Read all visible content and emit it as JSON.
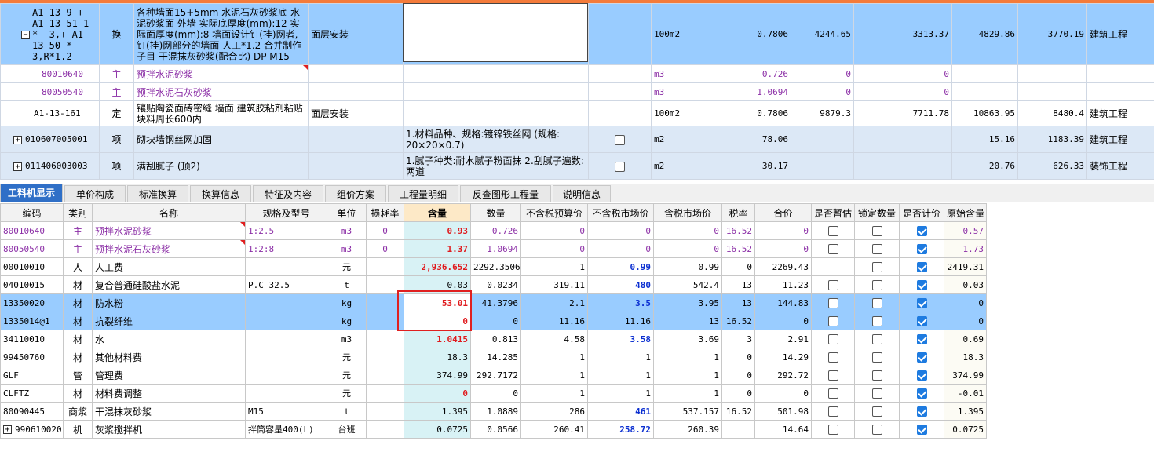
{
  "top_rows": [
    {
      "code": "A1-13-9 + A1-13-51-1 * -3,+ A1-13-50 * 3,R*1.2",
      "type": "换",
      "name": "各种墙面15+5mm 水泥石灰砂浆底 水泥砂浆面 外墙 实际底厚度(mm):12 实际面厚度(mm):8 墙面设计钉(挂)网者,钉(挂)网部分的墙面 人工*1.2 合并制作子目 干混抹灰砂浆(配合比) DP M15",
      "feature": "面层安装",
      "unit": "100m2",
      "qty": "0.7806",
      "p1": "4244.65",
      "p2": "3313.37",
      "p3": "4829.86",
      "p4": "3770.19",
      "major": "建筑工程"
    },
    {
      "code": "80010640",
      "type": "主",
      "name": "预拌水泥砂浆",
      "unit": "m3",
      "qty": "0.726",
      "p1": "0",
      "p2": "0"
    },
    {
      "code": "80050540",
      "type": "主",
      "name": "预拌水泥石灰砂浆",
      "unit": "m3",
      "qty": "1.0694",
      "p1": "0",
      "p2": "0"
    },
    {
      "code": "A1-13-161",
      "type": "定",
      "name": "镶贴陶瓷面砖密缝 墙面 建筑胶粘剂粘贴 块料周长600内",
      "feature": "面层安装",
      "unit": "100m2",
      "qty": "0.7806",
      "p1": "9879.3",
      "p2": "7711.78",
      "p3": "10863.95",
      "p4": "8480.4",
      "major": "建筑工程"
    },
    {
      "code": "010607005001",
      "type": "项",
      "name": "砌块墙钢丝网加固",
      "spec": "1.材料品种、规格:镀锌铁丝网 (规格: 20×20×0.7)",
      "unit": "m2",
      "qty": "78.06",
      "p3": "15.16",
      "p4": "1183.39",
      "major": "建筑工程"
    },
    {
      "code": "011406003003",
      "type": "项",
      "name": "满刮腻子 (顶2)",
      "spec": "1.腻子种类:耐水腻子粉面抹 2.刮腻子遍数:两道",
      "unit": "m2",
      "qty": "30.17",
      "p3": "20.76",
      "p4": "626.33",
      "major": "装饰工程"
    }
  ],
  "tabs": [
    "工料机显示",
    "单价构成",
    "标准换算",
    "换算信息",
    "特征及内容",
    "组价方案",
    "工程量明细",
    "反查图形工程量",
    "说明信息"
  ],
  "grid_headers": [
    "编码",
    "类别",
    "名称",
    "规格及型号",
    "单位",
    "损耗率",
    "含量",
    "数量",
    "不含税预算价",
    "不含税市场价",
    "含税市场价",
    "税率",
    "合价",
    "是否暂估",
    "锁定数量",
    "是否计价",
    "原始含量"
  ],
  "grid_rows": [
    {
      "code": "80010640",
      "cat": "主",
      "name": "预拌水泥砂浆",
      "spec": "1:2.5",
      "unit": "m3",
      "loss": "0",
      "content": "0.93",
      "qty": "0.726",
      "p1": "0",
      "p2": "0",
      "p3": "0",
      "tax": "16.52",
      "total": "0",
      "orig": "0.57"
    },
    {
      "code": "80050540",
      "cat": "主",
      "name": "预拌水泥石灰砂浆",
      "spec": "1:2:8",
      "unit": "m3",
      "loss": "0",
      "content": "1.37",
      "qty": "1.0694",
      "p1": "0",
      "p2": "0",
      "p3": "0",
      "tax": "16.52",
      "total": "0",
      "orig": "1.73"
    },
    {
      "code": "00010010",
      "cat": "人",
      "name": "人工费",
      "spec": "",
      "unit": "元",
      "loss": "",
      "content": "2,936.652",
      "qty": "2292.3506",
      "p1": "1",
      "p2": "0.99",
      "p3": "0.99",
      "tax": "0",
      "total": "2269.43",
      "orig": "2419.31"
    },
    {
      "code": "04010015",
      "cat": "材",
      "name": "复合普通硅酸盐水泥",
      "spec": "P.C 32.5",
      "unit": "t",
      "loss": "",
      "content": "0.03",
      "qty": "0.0234",
      "p1": "319.11",
      "p2": "480",
      "p3": "542.4",
      "tax": "13",
      "total": "11.23",
      "orig": "0.03"
    },
    {
      "code": "13350020",
      "cat": "材",
      "name": "防水粉",
      "spec": "",
      "unit": "kg",
      "loss": "",
      "content": "53.01",
      "qty": "41.3796",
      "p1": "2.1",
      "p2": "3.5",
      "p3": "3.95",
      "tax": "13",
      "total": "144.83",
      "orig": "0"
    },
    {
      "code": "1335014@1",
      "cat": "材",
      "name": "抗裂纤维",
      "spec": "",
      "unit": "kg",
      "loss": "",
      "content": "0",
      "qty": "0",
      "p1": "11.16",
      "p2": "11.16",
      "p3": "13",
      "tax": "16.52",
      "total": "0",
      "orig": "0"
    },
    {
      "code": "34110010",
      "cat": "材",
      "name": "水",
      "spec": "",
      "unit": "m3",
      "loss": "",
      "content": "1.0415",
      "qty": "0.813",
      "p1": "4.58",
      "p2": "3.58",
      "p3": "3.69",
      "tax": "3",
      "total": "2.91",
      "orig": "0.69"
    },
    {
      "code": "99450760",
      "cat": "材",
      "name": "其他材料费",
      "spec": "",
      "unit": "元",
      "loss": "",
      "content": "18.3",
      "qty": "14.285",
      "p1": "1",
      "p2": "1",
      "p3": "1",
      "tax": "0",
      "total": "14.29",
      "orig": "18.3"
    },
    {
      "code": "GLF",
      "cat": "管",
      "name": "管理费",
      "spec": "",
      "unit": "元",
      "loss": "",
      "content": "374.99",
      "qty": "292.7172",
      "p1": "1",
      "p2": "1",
      "p3": "1",
      "tax": "0",
      "total": "292.72",
      "orig": "374.99"
    },
    {
      "code": "CLFTZ",
      "cat": "材",
      "name": "材料费调整",
      "spec": "",
      "unit": "元",
      "loss": "",
      "content": "0",
      "qty": "0",
      "p1": "1",
      "p2": "1",
      "p3": "1",
      "tax": "0",
      "total": "0",
      "orig": "-0.01"
    },
    {
      "code": "80090445",
      "cat": "商浆",
      "name": "干混抹灰砂浆",
      "spec": "M15",
      "unit": "t",
      "loss": "",
      "content": "1.395",
      "qty": "1.0889",
      "p1": "286",
      "p2": "461",
      "p3": "537.157",
      "tax": "16.52",
      "total": "501.98",
      "orig": "1.395"
    },
    {
      "code": "990610020",
      "cat": "机",
      "name": "灰浆搅拌机",
      "spec": "拌筒容量400(L)",
      "unit": "台班",
      "loss": "",
      "content": "0.0725",
      "qty": "0.0566",
      "p1": "260.41",
      "p2": "258.72",
      "p3": "260.39",
      "tax": "",
      "total": "14.64",
      "orig": "0.0725"
    }
  ]
}
